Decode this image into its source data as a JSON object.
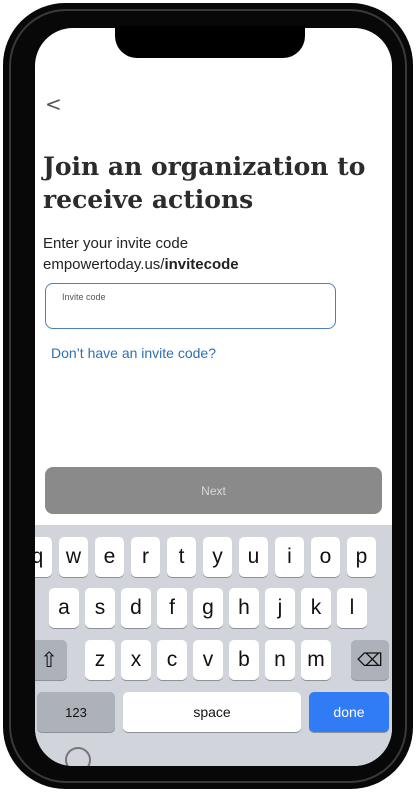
{
  "header": {
    "back_icon": "chevron-left-icon",
    "back_glyph": "<"
  },
  "main": {
    "title": "Join an organization to receive actions",
    "instruction_line1": "Enter your invite code",
    "instruction_domain": "empowertoday.us/",
    "instruction_code": "invitecode",
    "invite_field": {
      "placeholder": "Invite code",
      "value": ""
    },
    "no_code_link": "Don’t have an invite code?",
    "next_label": "Next"
  },
  "keyboard": {
    "row1": [
      "q",
      "w",
      "e",
      "r",
      "t",
      "y",
      "u",
      "i",
      "o",
      "p"
    ],
    "row2": [
      "a",
      "s",
      "d",
      "f",
      "g",
      "h",
      "j",
      "k",
      "l"
    ],
    "row3": [
      "z",
      "x",
      "c",
      "v",
      "b",
      "n",
      "m"
    ],
    "shift_glyph": "⇧",
    "delete_glyph": "⌫",
    "numbers_label": "123",
    "space_label": "space",
    "done_label": "done"
  },
  "colors": {
    "accent": "#2f6fb3",
    "next_disabled": "#8a8a8a",
    "done_key": "#2f7cf6",
    "keyboard_bg": "#d1d4da"
  }
}
